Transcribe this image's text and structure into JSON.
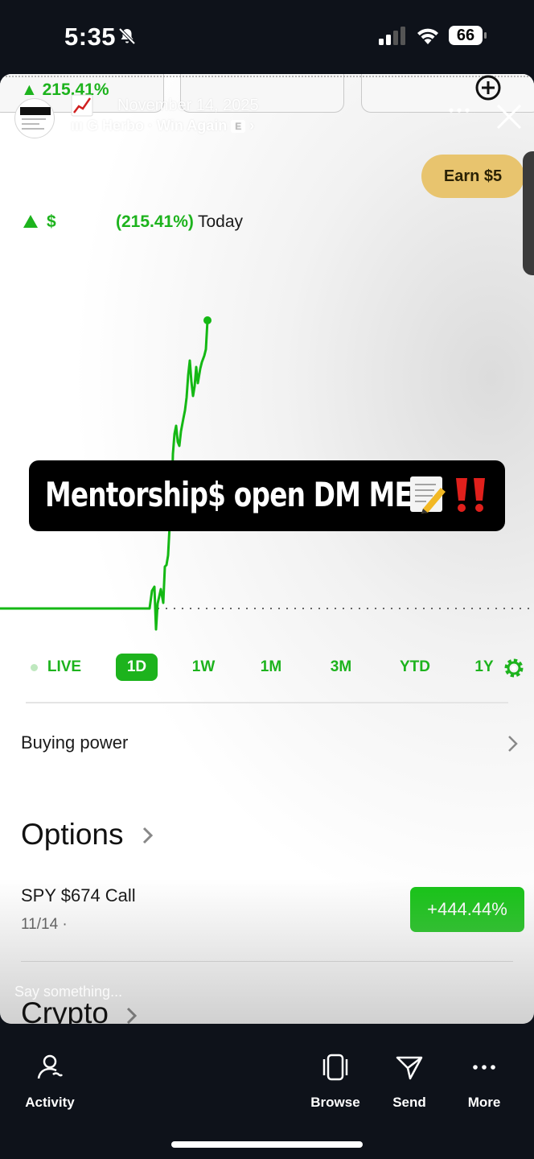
{
  "status_bar": {
    "time": "5:35",
    "battery": "66"
  },
  "story": {
    "top_percent": "▲ 215.41%",
    "date": "November 14, 2025",
    "music": "G Herbo · Win Again",
    "music_badge": "E",
    "caption": "Mentorship$ open DM ME",
    "reply_placeholder": "Say something..."
  },
  "screen": {
    "earn_button": "Earn $5",
    "gain_dollar": "$",
    "gain_percent": "(215.41%)",
    "gain_period": "Today",
    "ranges": [
      "LIVE",
      "1D",
      "1W",
      "1M",
      "3M",
      "YTD",
      "1Y"
    ],
    "selected_range": "1D",
    "buying_power_label": "Buying power",
    "options_title": "Options",
    "position_name": "SPY $674 Call",
    "position_sub": "11/14 ·",
    "position_change": "+444.44%",
    "crypto_title": "Crypto"
  },
  "colors": {
    "accent_green": "#1db31d",
    "earn_gold": "#e8c46e",
    "badge_green": "#15c315"
  },
  "nav": {
    "activity": "Activity",
    "browse": "Browse",
    "send": "Send",
    "more": "More"
  }
}
